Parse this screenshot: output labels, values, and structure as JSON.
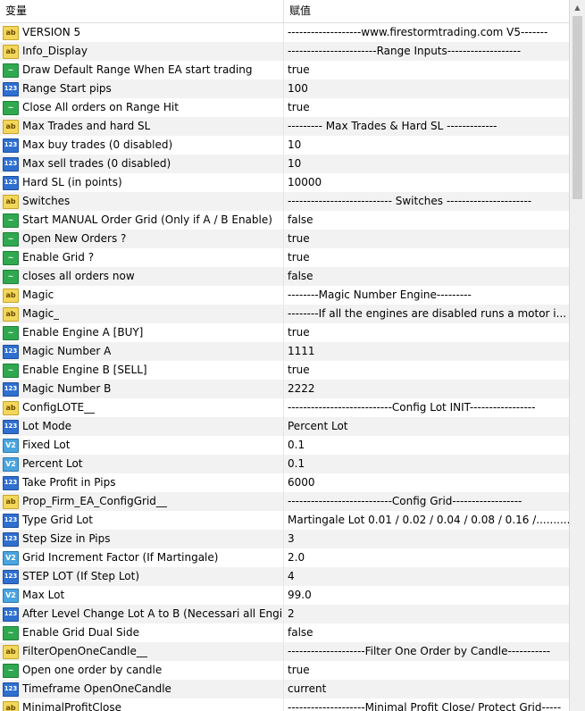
{
  "header": {
    "col_name": "变量",
    "col_value": "赋值"
  },
  "icons": {
    "string": "ab",
    "bool": "~",
    "int": "123",
    "double": "V2"
  },
  "rows": [
    {
      "type": "string",
      "name": "VERSION 5",
      "value": "-------------------www.firestormtrading.com V5-------"
    },
    {
      "type": "string",
      "name": "Info_Display",
      "value": "-----------------------Range Inputs-------------------"
    },
    {
      "type": "bool",
      "name": "Draw Default Range When EA start trading",
      "value": "true"
    },
    {
      "type": "int",
      "name": "Range Start pips",
      "value": "100"
    },
    {
      "type": "bool",
      "name": "Close All orders on Range Hit",
      "value": "true"
    },
    {
      "type": "string",
      "name": "Max Trades and hard SL",
      "value": "--------- Max Trades & Hard SL -------------"
    },
    {
      "type": "int",
      "name": "Max buy trades (0 disabled)",
      "value": "10"
    },
    {
      "type": "int",
      "name": "Max sell trades (0 disabled)",
      "value": "10"
    },
    {
      "type": "int",
      "name": "Hard SL (in points)",
      "value": "10000"
    },
    {
      "type": "string",
      "name": "Switches",
      "value": "--------------------------- Switches ----------------------"
    },
    {
      "type": "bool",
      "name": "Start MANUAL Order  Grid  (Only if A / B Enable)",
      "value": "false"
    },
    {
      "type": "bool",
      "name": "Open New Orders ?",
      "value": "true"
    },
    {
      "type": "bool",
      "name": "Enable Grid ?",
      "value": "true"
    },
    {
      "type": "bool",
      "name": "closes all orders now",
      "value": "false"
    },
    {
      "type": "string",
      "name": "Magic",
      "value": "--------Magic Number Engine---------"
    },
    {
      "type": "string",
      "name": "Magic_",
      "value": "--------If all the engines are disabled runs a motor i..."
    },
    {
      "type": "bool",
      "name": "Enable Engine A   [BUY]",
      "value": "true"
    },
    {
      "type": "int",
      "name": "Magic Number  A",
      "value": "1111"
    },
    {
      "type": "bool",
      "name": "Enable Engine B   [SELL]",
      "value": "true"
    },
    {
      "type": "int",
      "name": "Magic Number  B",
      "value": "2222"
    },
    {
      "type": "string",
      "name": "ConfigLOTE__",
      "value": "---------------------------Config Lot INIT-----------------"
    },
    {
      "type": "int",
      "name": "Lot Mode",
      "value": "Percent Lot"
    },
    {
      "type": "double",
      "name": "Fixed Lot",
      "value": "0.1"
    },
    {
      "type": "double",
      "name": "Percent Lot",
      "value": "0.1"
    },
    {
      "type": "int",
      "name": "Take Profit in Pips",
      "value": "6000"
    },
    {
      "type": "string",
      "name": "Prop_Firm_EA_ConfigGrid__",
      "value": "---------------------------Config Grid------------------"
    },
    {
      "type": "int",
      "name": "Type Grid Lot",
      "value": "Martingale Lot  0.01 / 0.02 / 0.04 / 0.08 / 0.16 /..........."
    },
    {
      "type": "int",
      "name": "Step Size in Pips",
      "value": "3"
    },
    {
      "type": "double",
      "name": "Grid Increment Factor (If Martingale)",
      "value": "2.0"
    },
    {
      "type": "int",
      "name": "STEP LOT (If  Step Lot)",
      "value": "4"
    },
    {
      "type": "double",
      "name": "Max Lot",
      "value": "99.0"
    },
    {
      "type": "int",
      "name": "After Level Change Lot A to B (Necessari all Engi...",
      "value": "2"
    },
    {
      "type": "bool",
      "name": "Enable Grid Dual Side",
      "value": "false"
    },
    {
      "type": "string",
      "name": "FilterOpenOneCandle__",
      "value": "--------------------Filter One Order by Candle-----------"
    },
    {
      "type": "bool",
      "name": "Open one order by candle",
      "value": "true"
    },
    {
      "type": "int",
      "name": "Timeframe OpenOneCandle",
      "value": "current"
    },
    {
      "type": "string",
      "name": "MinimalProfitClose",
      "value": "--------------------Minimal Profit Close/ Protect Grid-----"
    }
  ]
}
